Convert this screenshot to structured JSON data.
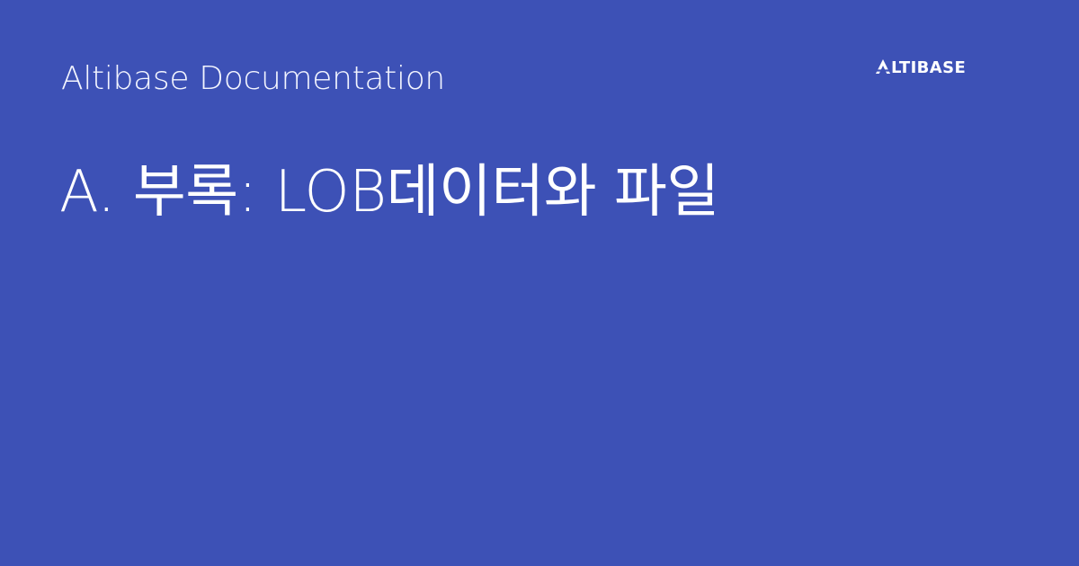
{
  "header": {
    "site_name": "Altibase Documentation",
    "logo_text": "ALTIBASE"
  },
  "page": {
    "title": "A. 부록: LOB데이터와 파일"
  },
  "colors": {
    "background": "#3d51b6",
    "text": "#ffffff"
  },
  "icons": {
    "logo": "altibase-logo-icon"
  }
}
